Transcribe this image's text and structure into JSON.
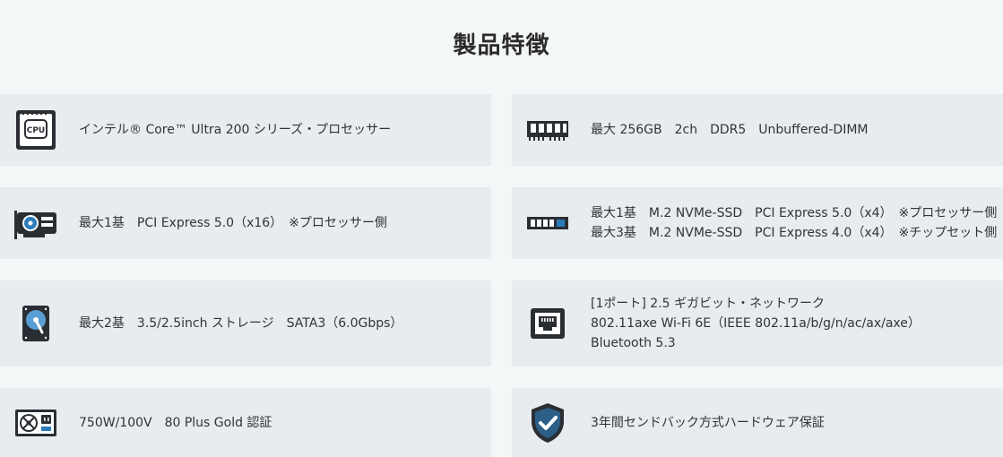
{
  "section_title": "製品特徴",
  "features": {
    "cpu": {
      "icon": "cpu-icon",
      "label": "CPU",
      "lines": [
        "インテル® Core™ Ultra 200 シリーズ・プロセッサー"
      ]
    },
    "memory": {
      "icon": "memory-icon",
      "lines": [
        "最大 256GB　2ch　DDR5　Unbuffered-DIMM"
      ]
    },
    "gpu": {
      "icon": "graphics-card-icon",
      "lines": [
        "最大1基　PCI Express 5.0（x16）　※プロセッサー側"
      ]
    },
    "ssd": {
      "icon": "ssd-icon",
      "lines": [
        "最大1基　M.2 NVMe-SSD　PCI Express 5.0（x4）　※プロセッサー側",
        "最大3基　M.2 NVMe-SSD　PCI Express 4.0（x4）　※チップセット側"
      ]
    },
    "hdd": {
      "icon": "hard-disk-icon",
      "lines": [
        "最大2基　3.5/2.5inch ストレージ　SATA3（6.0Gbps）"
      ]
    },
    "network": {
      "icon": "network-port-icon",
      "lines": [
        "[1ポート] 2.5 ギガビット・ネットワーク",
        "802.11axe Wi-Fi 6E（IEEE 802.11a/b/g/n/ac/ax/axe）",
        "Bluetooth 5.3"
      ]
    },
    "psu": {
      "icon": "power-supply-icon",
      "lines": [
        "750W/100V　80 Plus Gold 認証"
      ]
    },
    "warranty": {
      "icon": "shield-check-icon",
      "lines": [
        "3年間センドバック方式ハードウェア保証"
      ]
    }
  },
  "colors": {
    "card_bg": "#e6ecef",
    "page_bg": "#f4f7f8",
    "icon_dark": "#2a2e33",
    "icon_blue": "#2b7bb9"
  }
}
